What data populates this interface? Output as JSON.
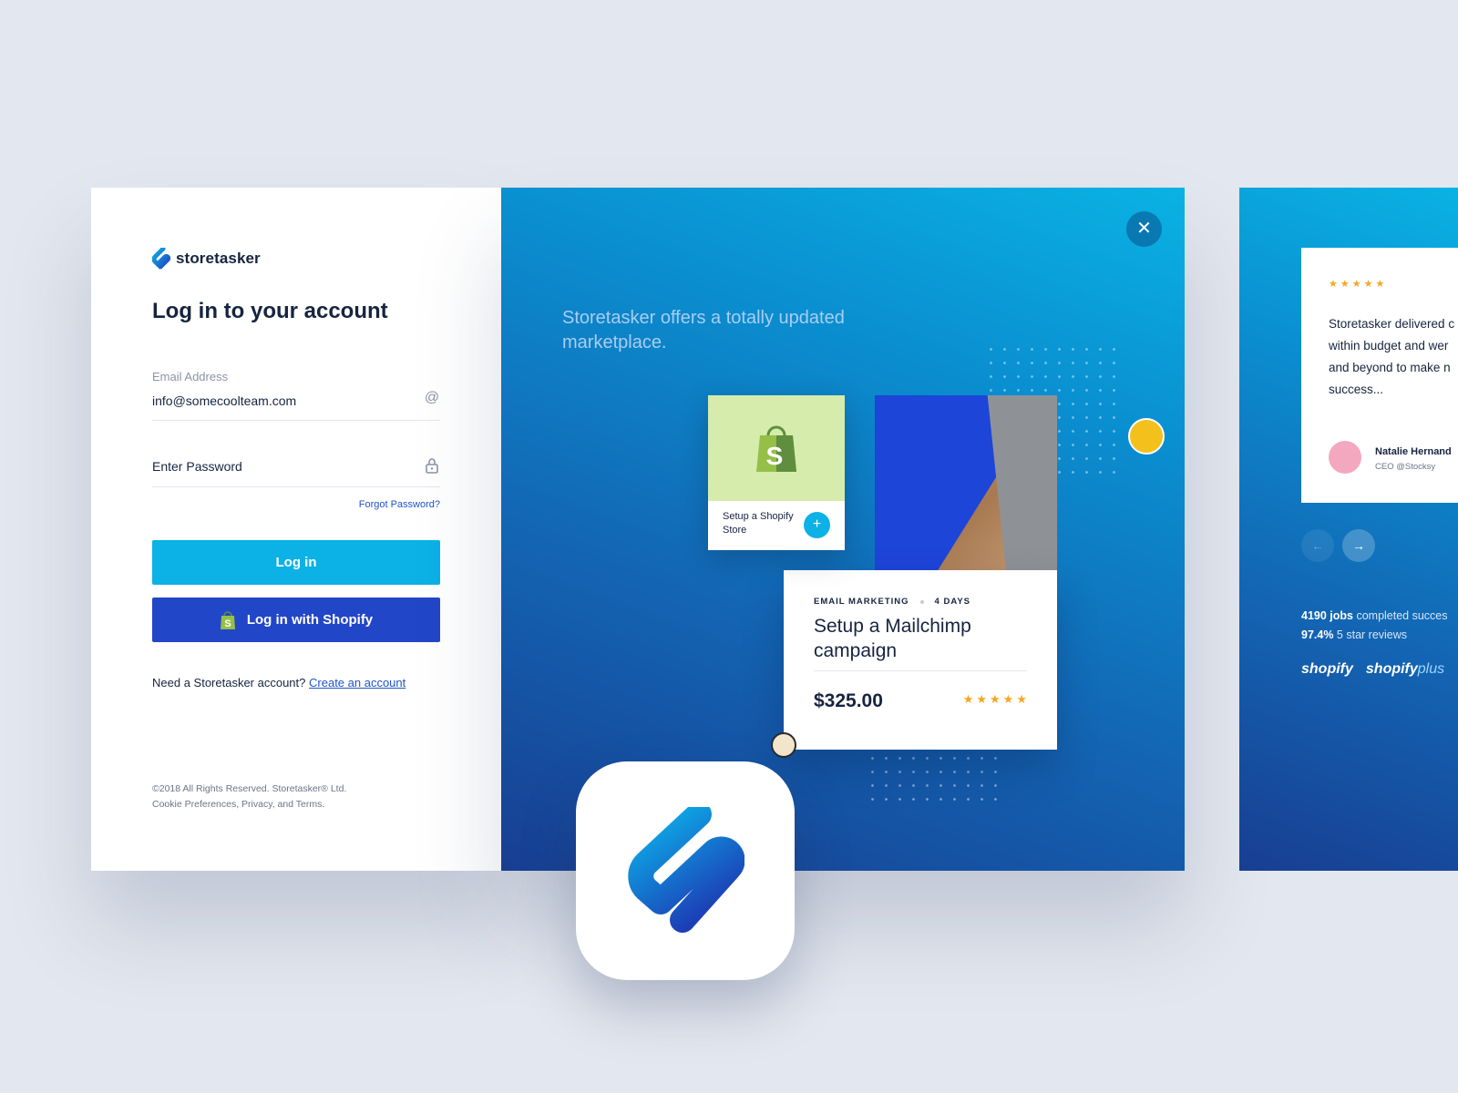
{
  "login": {
    "brand": "storetasker",
    "title": "Log in to your account",
    "email_label": "Email Address",
    "email_value": "info@somecoolteam.com",
    "password_placeholder": "Enter Password",
    "forgot": "Forgot Password?",
    "login_button": "Log in",
    "shopify_button": "Log in with Shopify",
    "signup_prompt": "Need a Storetasker account?",
    "signup_link": "Create an account",
    "legal_line1": "©2018 All Rights Reserved. Storetasker® Ltd.",
    "legal_line2": "Cookie Preferences, Privacy, and Terms."
  },
  "promo": {
    "tagline": "Storetasker offers a totally updated marketplace.",
    "shop_card_label": "Setup a Shopify Store",
    "job": {
      "category": "EMAIL MARKETING",
      "duration": "4 DAYS",
      "title": "Setup a Mailchimp campaign",
      "price": "$325.00",
      "stars": "★★★★★"
    }
  },
  "testimonial": {
    "stars": "★★★★★",
    "text_lines": [
      "Storetasker delivered c",
      "within budget and wer",
      "and beyond to make n",
      "success..."
    ],
    "name": "Natalie Hernand",
    "role": "CEO @Stocksy",
    "stat1_bold": "4190 jobs",
    "stat1_rest": " completed succes",
    "stat2_bold": "97.4%",
    "stat2_rest": " 5 star reviews",
    "brand1": "shopify",
    "brand2": "shopify",
    "brand2_suffix": "plus"
  },
  "icons": {
    "email": "at-icon",
    "password": "lock-icon",
    "close": "close-icon",
    "plus": "plus-icon",
    "prev": "arrow-left-icon",
    "next": "arrow-right-icon"
  },
  "colors": {
    "accent": "#0cb1e6",
    "shopify_button": "#2246c8",
    "brand_dark": "#16243f",
    "star": "#f6a623",
    "shopify_green": "#95bf47"
  }
}
